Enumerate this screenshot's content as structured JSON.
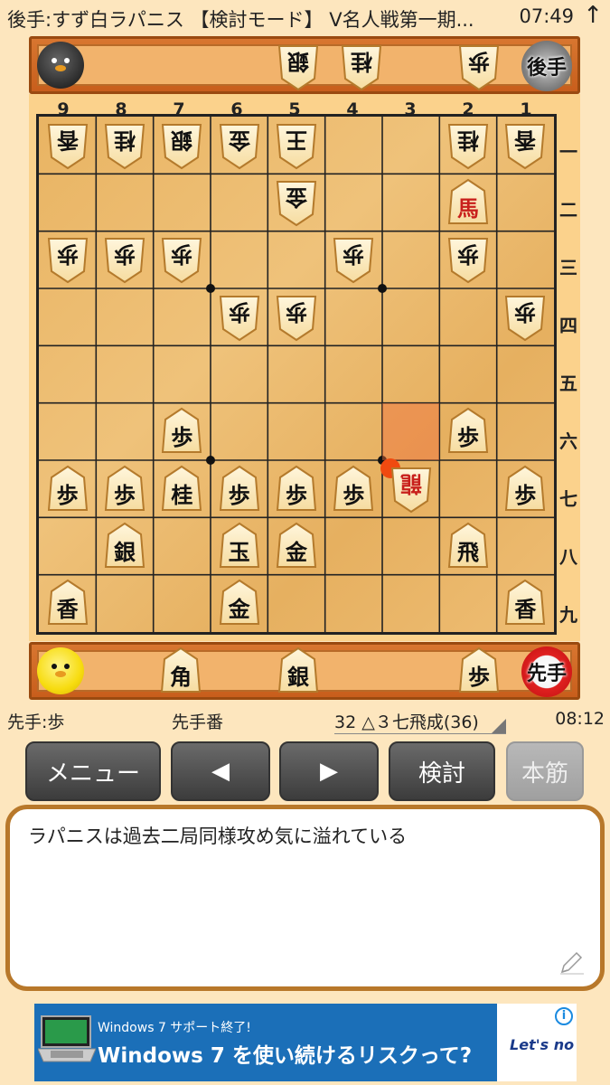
{
  "status_bar": {
    "title": "後手:すず白ラパニス 【検討モード】 V名人戦第一期...",
    "time": "07:49",
    "arrow": "↑"
  },
  "gote_hand": {
    "pieces": [
      "銀",
      "桂",
      "歩"
    ],
    "badge": "後手"
  },
  "sente_hand": {
    "pieces": [
      "角",
      "銀",
      "歩"
    ],
    "badge": "先手"
  },
  "board": {
    "file_labels": [
      "9",
      "8",
      "7",
      "6",
      "5",
      "4",
      "3",
      "2",
      "1"
    ],
    "rank_labels": [
      "一",
      "二",
      "三",
      "四",
      "五",
      "六",
      "七",
      "八",
      "九"
    ],
    "highlight_square": {
      "file": 3,
      "rank": 6
    },
    "last_move_square": {
      "file": 3,
      "rank": 7
    },
    "pieces": [
      {
        "file": 9,
        "rank": 1,
        "char": "香",
        "owner": "gote"
      },
      {
        "file": 8,
        "rank": 1,
        "char": "桂",
        "owner": "gote"
      },
      {
        "file": 7,
        "rank": 1,
        "char": "銀",
        "owner": "gote"
      },
      {
        "file": 6,
        "rank": 1,
        "char": "金",
        "owner": "gote"
      },
      {
        "file": 5,
        "rank": 1,
        "char": "王",
        "owner": "gote"
      },
      {
        "file": 2,
        "rank": 1,
        "char": "桂",
        "owner": "gote"
      },
      {
        "file": 1,
        "rank": 1,
        "char": "香",
        "owner": "gote"
      },
      {
        "file": 5,
        "rank": 2,
        "char": "金",
        "owner": "gote"
      },
      {
        "file": 2,
        "rank": 2,
        "char": "馬",
        "owner": "sente",
        "promoted": true
      },
      {
        "file": 9,
        "rank": 3,
        "char": "歩",
        "owner": "gote"
      },
      {
        "file": 8,
        "rank": 3,
        "char": "歩",
        "owner": "gote"
      },
      {
        "file": 7,
        "rank": 3,
        "char": "歩",
        "owner": "gote"
      },
      {
        "file": 4,
        "rank": 3,
        "char": "歩",
        "owner": "gote"
      },
      {
        "file": 2,
        "rank": 3,
        "char": "歩",
        "owner": "gote"
      },
      {
        "file": 6,
        "rank": 4,
        "char": "歩",
        "owner": "gote"
      },
      {
        "file": 5,
        "rank": 4,
        "char": "歩",
        "owner": "gote"
      },
      {
        "file": 1,
        "rank": 4,
        "char": "歩",
        "owner": "gote"
      },
      {
        "file": 7,
        "rank": 6,
        "char": "歩",
        "owner": "sente"
      },
      {
        "file": 2,
        "rank": 6,
        "char": "歩",
        "owner": "sente"
      },
      {
        "file": 9,
        "rank": 7,
        "char": "歩",
        "owner": "sente"
      },
      {
        "file": 8,
        "rank": 7,
        "char": "歩",
        "owner": "sente"
      },
      {
        "file": 7,
        "rank": 7,
        "char": "桂",
        "owner": "sente"
      },
      {
        "file": 6,
        "rank": 7,
        "char": "歩",
        "owner": "sente"
      },
      {
        "file": 5,
        "rank": 7,
        "char": "歩",
        "owner": "sente"
      },
      {
        "file": 4,
        "rank": 7,
        "char": "歩",
        "owner": "sente"
      },
      {
        "file": 3,
        "rank": 7,
        "char": "龍",
        "owner": "gote",
        "promoted": true
      },
      {
        "file": 1,
        "rank": 7,
        "char": "歩",
        "owner": "sente"
      },
      {
        "file": 8,
        "rank": 8,
        "char": "銀",
        "owner": "sente"
      },
      {
        "file": 6,
        "rank": 8,
        "char": "玉",
        "owner": "sente"
      },
      {
        "file": 5,
        "rank": 8,
        "char": "金",
        "owner": "sente"
      },
      {
        "file": 2,
        "rank": 8,
        "char": "飛",
        "owner": "sente"
      },
      {
        "file": 9,
        "rank": 9,
        "char": "香",
        "owner": "sente"
      },
      {
        "file": 6,
        "rank": 9,
        "char": "金",
        "owner": "sente"
      },
      {
        "file": 1,
        "rank": 9,
        "char": "香",
        "owner": "sente"
      }
    ]
  },
  "info": {
    "sente_last": "先手:歩",
    "turn": "先手番",
    "move": "32 △３七飛成(36)",
    "time": "08:12"
  },
  "buttons": {
    "menu": "メニュー",
    "prev": "◀",
    "next": "▶",
    "kento": "検討",
    "honsuji": "本筋"
  },
  "comment": {
    "text": "ラパニスは過去二局同様攻め気に溢れている"
  },
  "ad": {
    "small": "Windows 7 サポート終了!",
    "big": "Windows 7 を使い続けるリスクって?",
    "brand": "Let's no",
    "info": "i"
  }
}
